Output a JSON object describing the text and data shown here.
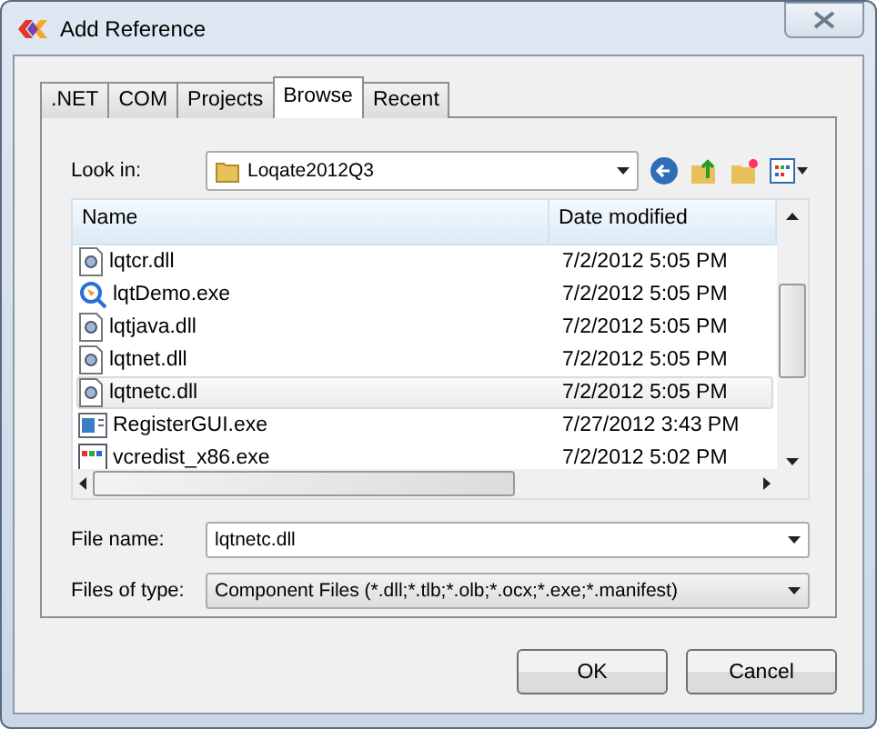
{
  "window": {
    "title": "Add Reference"
  },
  "tabs": [
    {
      "label": ".NET",
      "selected": false
    },
    {
      "label": "COM",
      "selected": false
    },
    {
      "label": "Projects",
      "selected": false
    },
    {
      "label": "Browse",
      "selected": true
    },
    {
      "label": "Recent",
      "selected": false
    }
  ],
  "look_in": {
    "label": "Look in:",
    "value": "Loqate2012Q3"
  },
  "file_list": {
    "columns": [
      "Name",
      "Date modified"
    ],
    "rows": [
      {
        "name": "lqtcr.dll",
        "date": "7/2/2012 5:05 PM",
        "kind": "dll",
        "selected": false
      },
      {
        "name": "lqtDemo.exe",
        "date": "7/2/2012 5:05 PM",
        "kind": "demo",
        "selected": false
      },
      {
        "name": "lqtjava.dll",
        "date": "7/2/2012 5:05 PM",
        "kind": "dll",
        "selected": false
      },
      {
        "name": "lqtnet.dll",
        "date": "7/2/2012 5:05 PM",
        "kind": "dll",
        "selected": false
      },
      {
        "name": "lqtnetc.dll",
        "date": "7/2/2012 5:05 PM",
        "kind": "dll",
        "selected": true
      },
      {
        "name": "RegisterGUI.exe",
        "date": "7/27/2012 3:43 PM",
        "kind": "app",
        "selected": false
      },
      {
        "name": "vcredist_x86.exe",
        "date": "7/2/2012 5:02 PM",
        "kind": "installer",
        "selected": false
      }
    ]
  },
  "file_name": {
    "label": "File name:",
    "value": "lqtnetc.dll"
  },
  "files_of_type": {
    "label": "Files of type:",
    "value": "Component Files (*.dll;*.tlb;*.olb;*.ocx;*.exe;*.manifest)"
  },
  "buttons": [
    "OK",
    "Cancel"
  ]
}
